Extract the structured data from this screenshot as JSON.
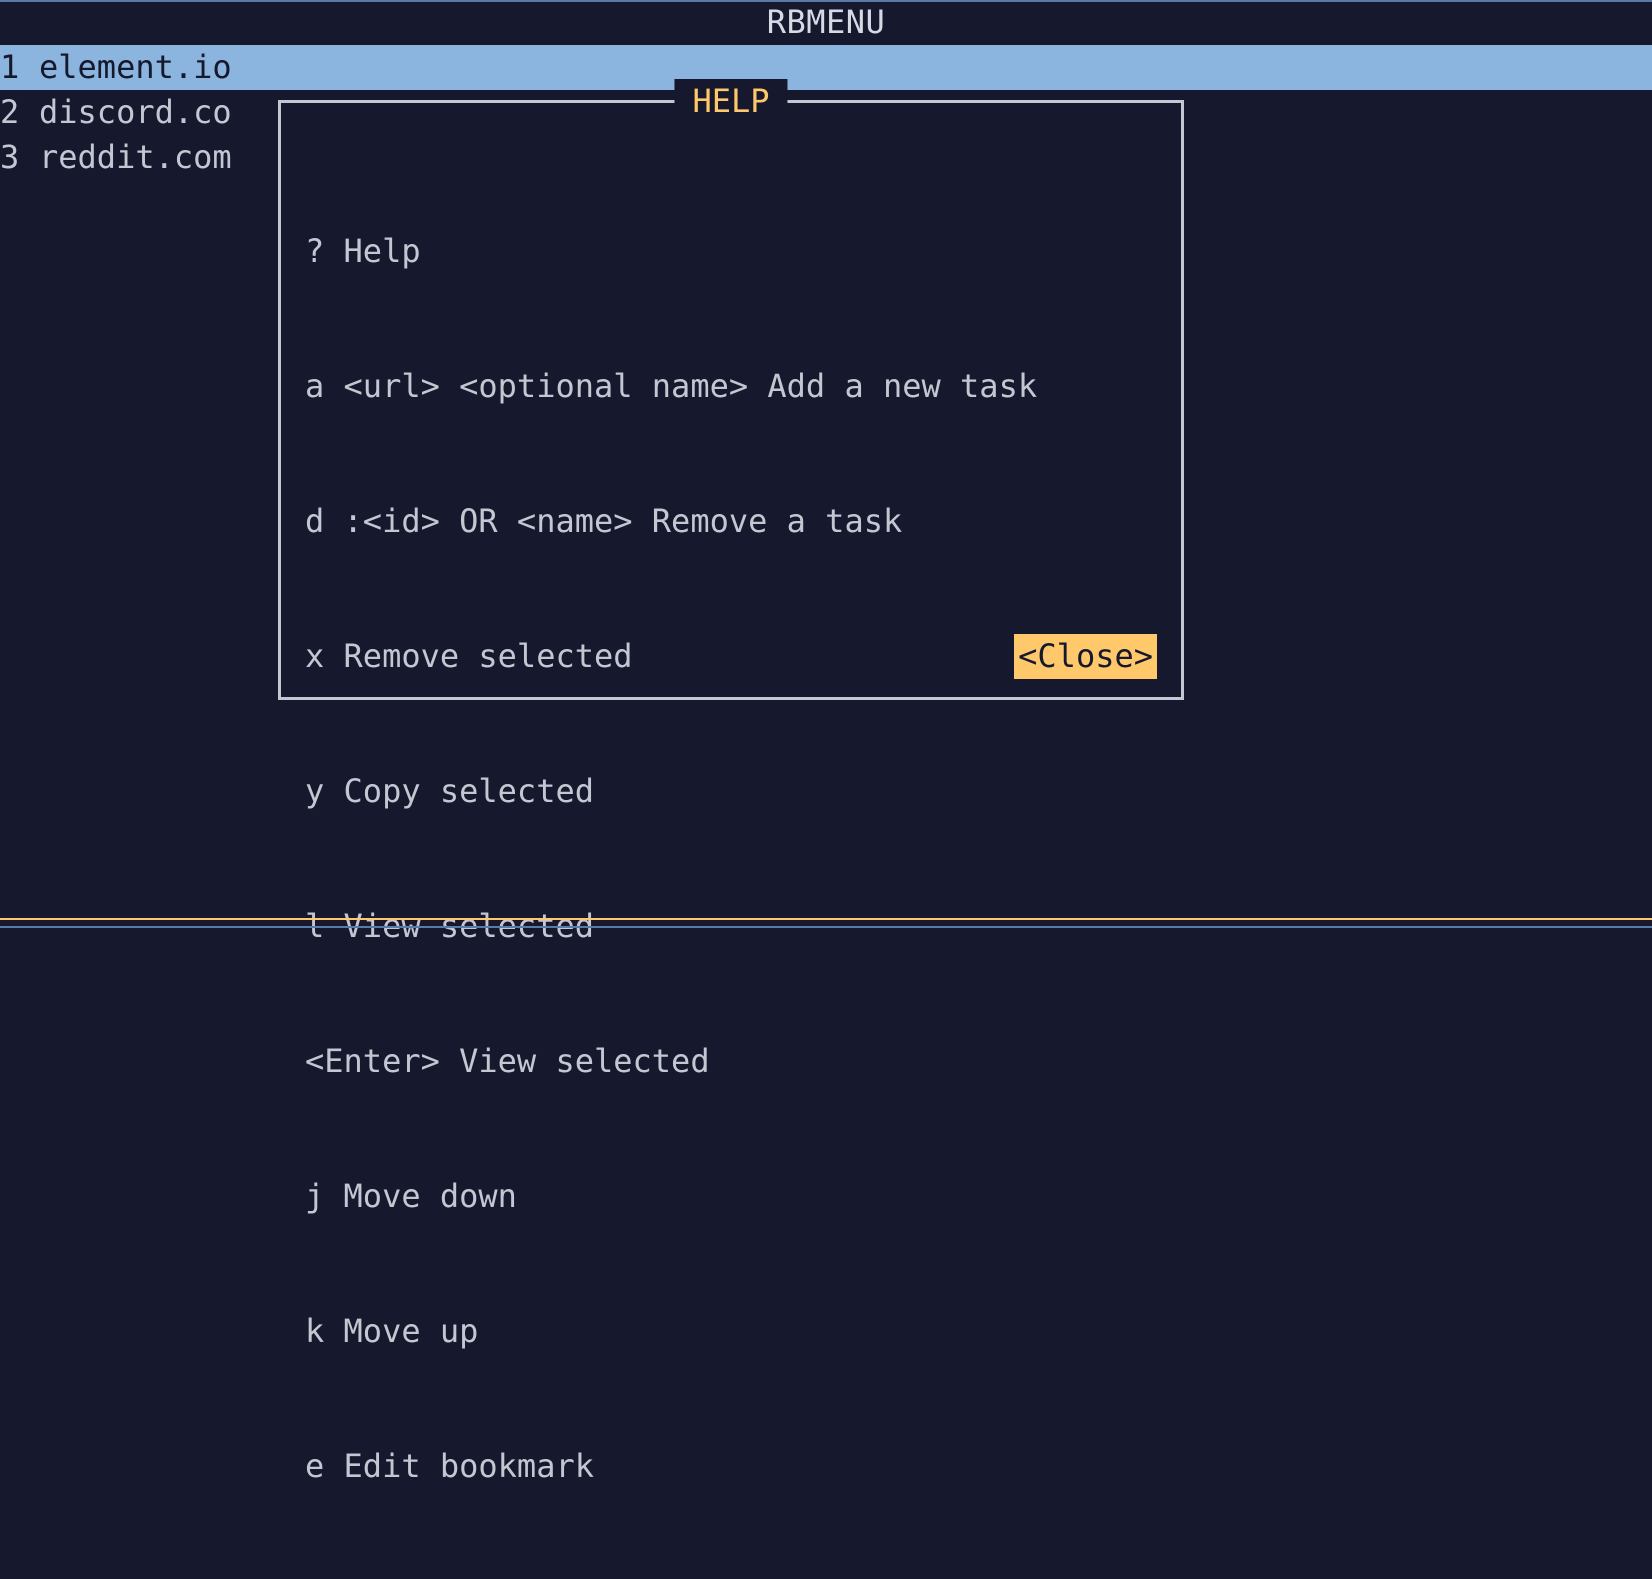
{
  "app_title": "RBMENU",
  "list": {
    "items": [
      {
        "index": "1",
        "label": "element.io",
        "selected": true
      },
      {
        "index": "2",
        "label": "discord.co",
        "selected": false
      },
      {
        "index": "3",
        "label": "reddit.com",
        "selected": false
      }
    ]
  },
  "help": {
    "title": "HELP",
    "lines": [
      "? Help",
      "a <url> <optional name> Add a new task",
      "d :<id> OR <name> Remove a task",
      "x Remove selected",
      "y Copy selected",
      "l View selected",
      "<Enter> View selected",
      "j Move down",
      "k Move up",
      "e Edit bookmark"
    ],
    "close_label": "<Close>"
  }
}
